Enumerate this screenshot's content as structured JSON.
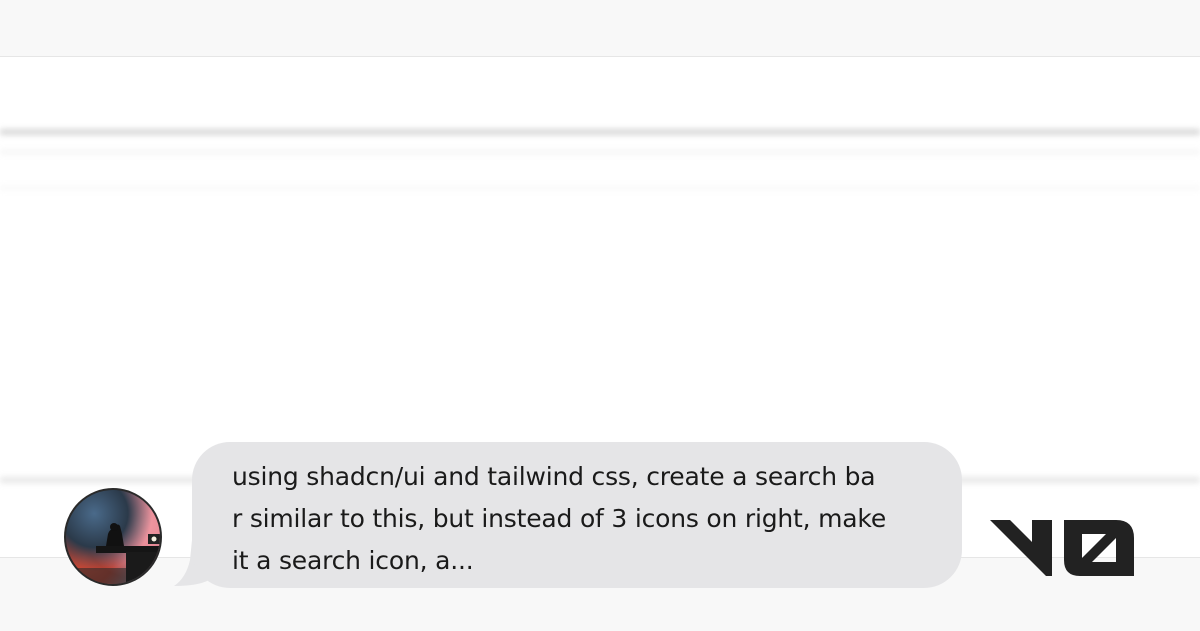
{
  "message": {
    "text": "using shadcn/ui and tailwind css, create a search ba\nr similar to this, but instead of 3 icons on right, make\nit a search icon, a..."
  },
  "brand": {
    "logo_text": "v0"
  },
  "colors": {
    "bubble": "#e5e5e7",
    "text": "#1a1a1a",
    "logo": "#222222",
    "background": "#ffffff",
    "band": "#f8f8f8"
  },
  "icons": {
    "avatar": "user-avatar-photo",
    "logo": "v0-logo-icon"
  }
}
